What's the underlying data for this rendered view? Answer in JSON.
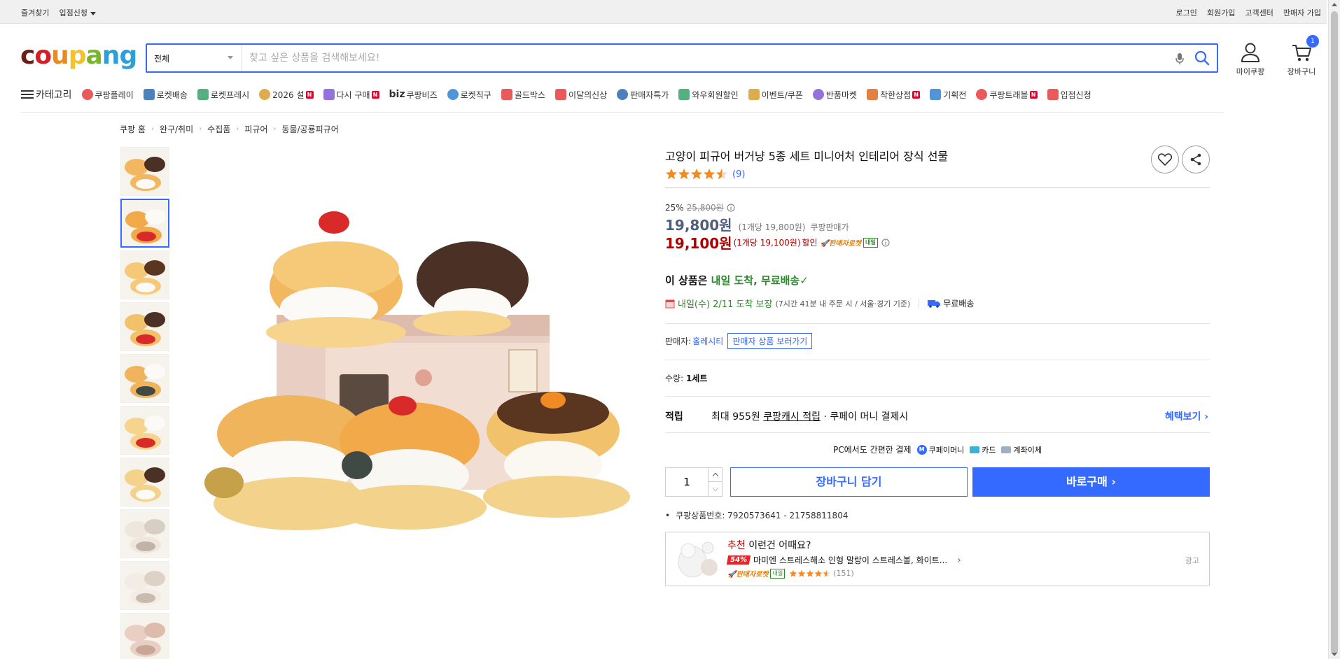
{
  "topbar": {
    "left": [
      "즐겨찾기",
      "입점신청"
    ],
    "right": [
      "로그인",
      "회원가입",
      "고객센터",
      "판매자 가입"
    ]
  },
  "header": {
    "logo_letters": [
      "c",
      "o",
      "u",
      "p",
      "a",
      "n",
      "g"
    ],
    "logo_colors": [
      "#6b1e17",
      "#d41f26",
      "#e88b1e",
      "#f5c12b",
      "#78b52a",
      "#2c9fd7",
      "#2c9fd7"
    ],
    "search_category": "전체",
    "search_placeholder": "찾고 싶은 상품을 검색해보세요!",
    "mypage_label": "마이쿠팡",
    "cart_label": "장바구니",
    "cart_count": "1"
  },
  "catnav": {
    "category_label": "카테고리",
    "items": [
      {
        "label": "쿠팡플레이",
        "icon": "play-icon",
        "new": false
      },
      {
        "label": "로켓배송",
        "icon": "rocket-icon",
        "new": false
      },
      {
        "label": "로켓프레시",
        "icon": "rocket-fresh-icon",
        "new": false
      },
      {
        "label": "2026 설",
        "icon": "gift-icon",
        "new": true
      },
      {
        "label": "다시 구매",
        "icon": "home-icon",
        "new": true
      },
      {
        "label": "쿠팡비즈",
        "icon": "biz-icon",
        "new": false
      },
      {
        "label": "로켓직구",
        "icon": "global-icon",
        "new": false
      },
      {
        "label": "골드박스",
        "icon": "goldbox-icon",
        "new": false
      },
      {
        "label": "이달의신상",
        "icon": "new-bag-icon",
        "new": false
      },
      {
        "label": "판매자특가",
        "icon": "percent-icon",
        "new": false
      },
      {
        "label": "와우회원할인",
        "icon": "wow-icon",
        "new": false
      },
      {
        "label": "이벤트/쿠폰",
        "icon": "coupon-icon",
        "new": false
      },
      {
        "label": "반품마켓",
        "icon": "return-icon",
        "new": false
      },
      {
        "label": "착한상점",
        "icon": "store-icon",
        "new": true
      },
      {
        "label": "기획전",
        "icon": "tag-icon",
        "new": false
      },
      {
        "label": "쿠팡트래블",
        "icon": "travel-icon",
        "new": true
      },
      {
        "label": "입점신청",
        "icon": "register-icon",
        "new": false
      }
    ],
    "biz_prefix": "biz"
  },
  "breadcrumb": [
    "쿠팡 홈",
    "완구/취미",
    "수집품",
    "피규어",
    "동물/공룡피규어"
  ],
  "product": {
    "title": "고양이 피규어 버거냥 5종 세트 미니어처 인테리어 장식 선물",
    "review_count": "(9)",
    "rating": 4.5,
    "discount_rate": "25%",
    "original_price": "25,800원",
    "coupang_price": "19,800원",
    "coupang_unit": "(1개당 19,800원)",
    "coupang_label": "쿠팡판매가",
    "sale_price": "19,100원",
    "sale_unit": "(1개당 19,100원)",
    "sale_label": "할인",
    "rocket_label": "판매자로켓",
    "tomorrow_tag": "내일",
    "delivery_head_pre": "이 상품은",
    "delivery_head_green": "내일 도착, 무료배송",
    "delivery_date": "내일(수) 2/11 도착 보장",
    "delivery_sub": "(7시간 41분 내 주문 시 / 서울·경기 기준)",
    "free_shipping": "무료배송",
    "seller_label": "판매자:",
    "seller_name": "홀레시티",
    "seller_btn": "판매자 상품 보러가기",
    "qty_label": "수량:",
    "qty_value": "1세트",
    "reward_key": "적립",
    "reward_pre": "최대 955원",
    "reward_link": "쿠팡캐시 적립",
    "reward_post": "· 쿠페이 머니 결제시",
    "reward_more": "혜택보기 ›",
    "pay_title": "PC에서도 간편한 결제",
    "pay_methods": [
      "쿠페이머니",
      "카드",
      "계좌이체"
    ],
    "qty_input": "1",
    "cart_btn": "장바구니 담기",
    "buy_btn": "바로구매 ›",
    "product_id": "쿠팡상품번호: 7920573641 - 21758811804"
  },
  "recommend": {
    "title_red": "추천",
    "title_rest": "이런건 어때요?",
    "discount": "54%",
    "name": "마미엔 스트레스해소 인형 말랑이 스트레스볼, 화이트...",
    "rocket": "판매자로켓",
    "tomorrow": "내일",
    "count": "(151)",
    "ad": "광고"
  },
  "colors": {
    "accent": "#346aff",
    "sale_red": "#ae0000",
    "green": "#2b8a2b"
  }
}
